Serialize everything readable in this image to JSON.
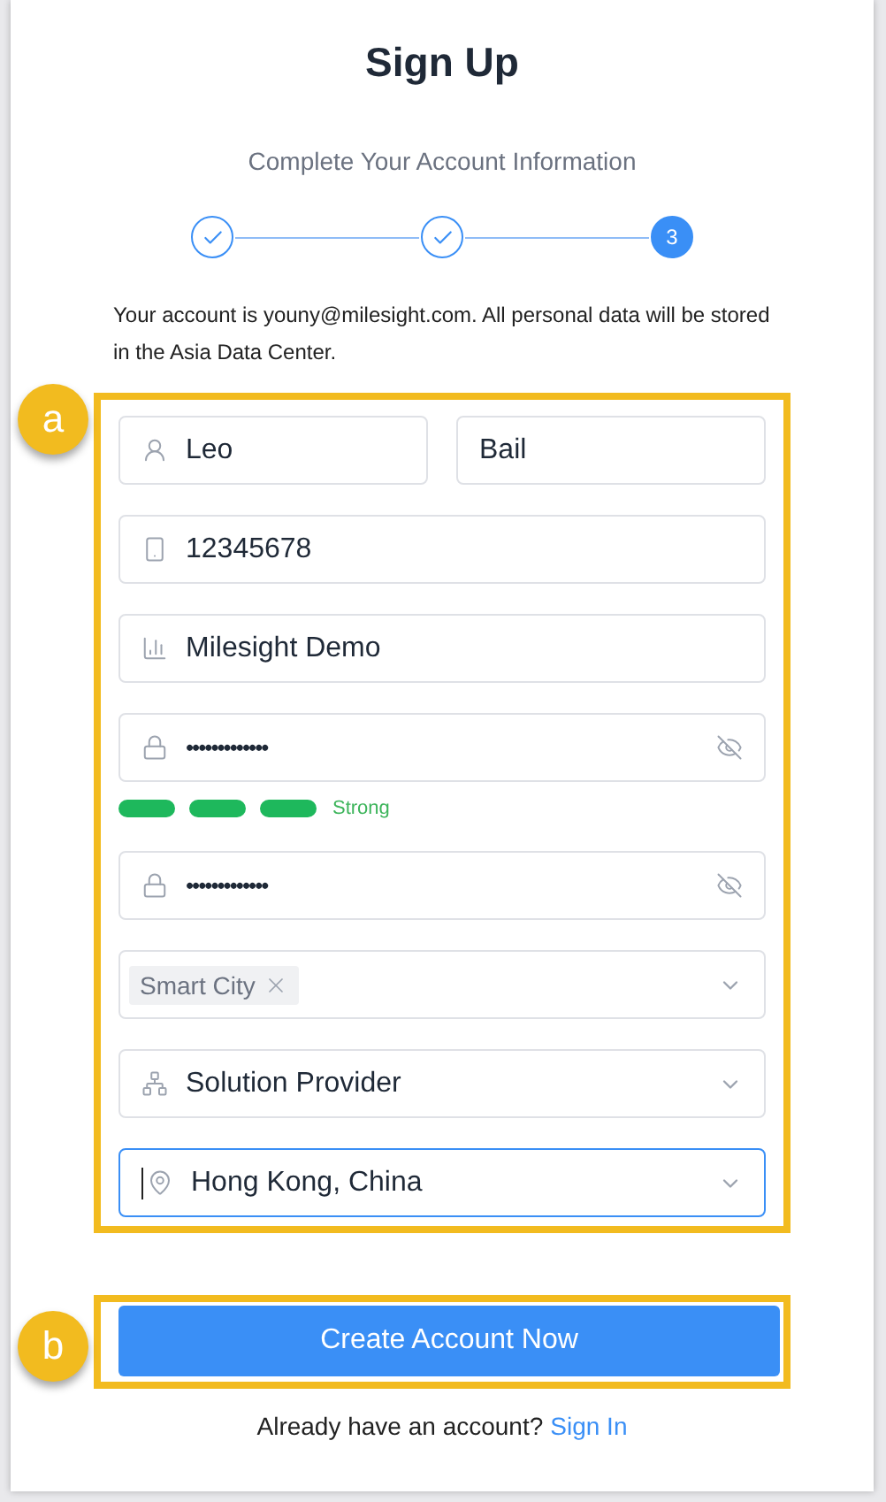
{
  "title": "Sign Up",
  "subtitle": "Complete Your Account Information",
  "steps": [
    {
      "done": true
    },
    {
      "done": true
    },
    {
      "done": false,
      "label": "3"
    }
  ],
  "notice": "Your account is youny@milesight.com. All personal data will be stored in the Asia Data Center.",
  "fields": [
    {
      "kind": "name_pair",
      "values": [
        "Leo",
        "Bail"
      ]
    },
    {
      "kind": "text",
      "value": "12345678"
    },
    {
      "kind": "text",
      "value": "Milesight Demo"
    },
    {
      "kind": "password",
      "value": "•••••••••••••",
      "strength": {
        "label": "Strong"
      }
    },
    {
      "kind": "password",
      "value": "•••••••••••••"
    },
    {
      "kind": "tags",
      "tags": [
        "Smart City"
      ]
    },
    {
      "kind": "select",
      "value": "Solution Provider",
      "focused": false
    },
    {
      "kind": "select",
      "value": "Hong Kong, China",
      "focused": true
    }
  ],
  "submit": "Create Account Now",
  "footer": {
    "text": "Already have an account?",
    "link": "Sign In"
  },
  "callouts": [
    "a",
    "b"
  ]
}
